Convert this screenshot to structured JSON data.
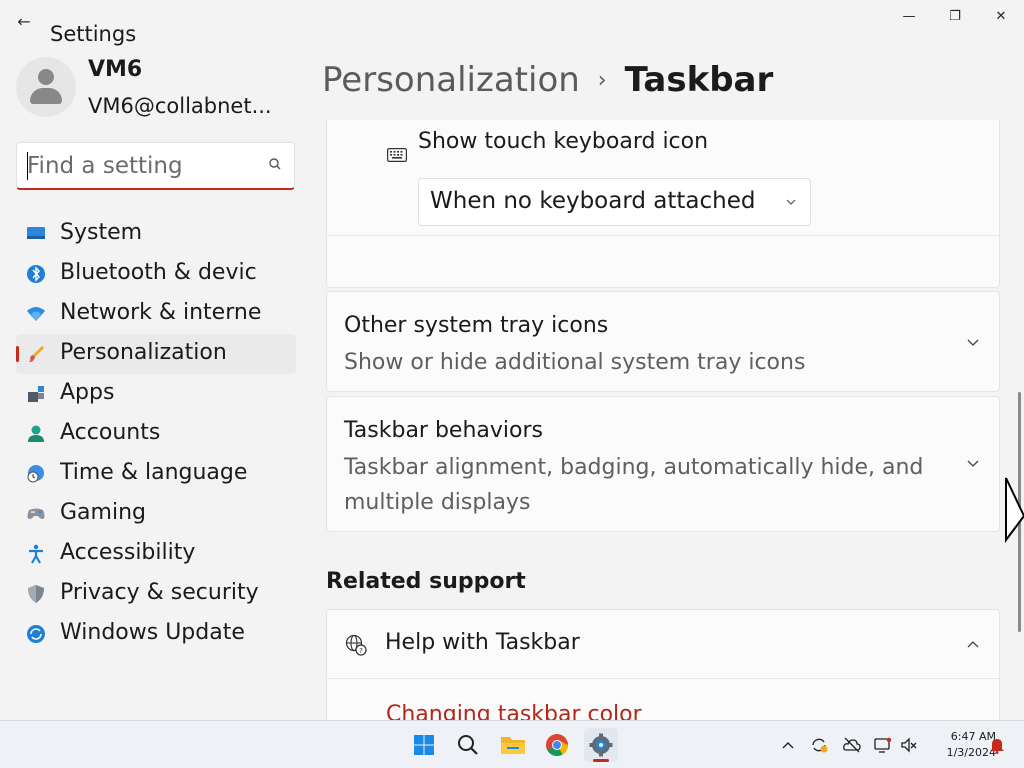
{
  "window": {
    "app_title": "Settings",
    "back_glyph": "←",
    "minimize_glyph": "—",
    "maximize_glyph": "❐",
    "close_glyph": "✕"
  },
  "user": {
    "name": "VM6",
    "email": "VM6@collabnet..."
  },
  "search": {
    "placeholder": "Find a setting",
    "value": ""
  },
  "sidebar": {
    "active_index": 3,
    "items": [
      {
        "label": "System",
        "icon": "system-icon"
      },
      {
        "label": "Bluetooth & devic",
        "icon": "bluetooth-icon"
      },
      {
        "label": "Network & interne",
        "icon": "wifi-icon"
      },
      {
        "label": "Personalization",
        "icon": "brush-icon"
      },
      {
        "label": "Apps",
        "icon": "apps-icon"
      },
      {
        "label": "Accounts",
        "icon": "accounts-icon"
      },
      {
        "label": "Time & language",
        "icon": "globe-clock-icon"
      },
      {
        "label": "Gaming",
        "icon": "controller-icon"
      },
      {
        "label": "Accessibility",
        "icon": "accessibility-icon"
      },
      {
        "label": "Privacy & security",
        "icon": "shield-icon"
      },
      {
        "label": "Windows Update",
        "icon": "update-icon"
      }
    ]
  },
  "breadcrumb": {
    "parent": "Personalization",
    "separator": "›",
    "current": "Taskbar"
  },
  "touch_keyboard": {
    "label": "Show touch keyboard icon",
    "selected": "When no keyboard attached"
  },
  "sections": {
    "tray": {
      "title": "Other system tray icons",
      "subtitle": "Show or hide additional system tray icons"
    },
    "behaviors": {
      "title": "Taskbar behaviors",
      "subtitle": "Taskbar alignment, badging, automatically hide, and multiple displays"
    }
  },
  "related_support": {
    "heading": "Related support",
    "help_title": "Help with Taskbar",
    "link": "Changing taskbar color"
  },
  "taskbar": {
    "apps": [
      "start-icon",
      "search-icon",
      "file-explorer-icon",
      "chrome-icon",
      "settings-icon"
    ],
    "time": "6:47 AM",
    "date": "1/3/2024"
  },
  "colors": {
    "accent": "#c42b1c",
    "background": "#f3f3f3",
    "card": "#fbfbfb"
  }
}
